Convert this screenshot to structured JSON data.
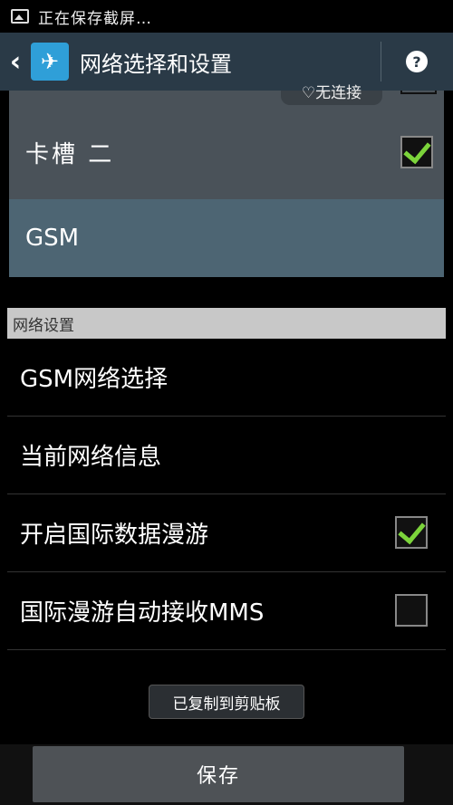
{
  "status_bar": {
    "text": "正在保存截屏…",
    "icon": "image-icon"
  },
  "action_bar": {
    "back_icon": "chevron-left-icon",
    "app_icon": "airplane-icon",
    "title": "网络选择和设置",
    "help_icon": "question-icon"
  },
  "dialog": {
    "badge": "无连接",
    "sim2_label": "卡槽 二",
    "sim2_checked": true,
    "network_type": "GSM"
  },
  "section": {
    "title": "网络设置"
  },
  "items": [
    {
      "label": "GSM网络选择"
    },
    {
      "label": "当前网络信息"
    },
    {
      "label": "开启国际数据漫游",
      "checked": true
    },
    {
      "label": "国际漫游自动接收MMS",
      "checked": false
    }
  ],
  "toast": {
    "text": "已复制到剪贴板"
  },
  "footer": {
    "save_label": "保存"
  }
}
